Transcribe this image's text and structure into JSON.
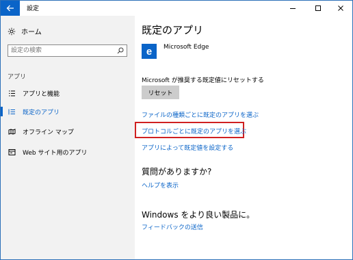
{
  "titlebar": {
    "title": "設定"
  },
  "sidebar": {
    "home_label": "ホーム",
    "search_placeholder": "設定の検索",
    "section_label": "アプリ",
    "items": [
      {
        "label": "アプリと機能",
        "icon": "list-icon",
        "active": false
      },
      {
        "label": "既定のアプリ",
        "icon": "default-apps-icon",
        "active": true
      },
      {
        "label": "オフライン マップ",
        "icon": "map-icon",
        "active": false
      },
      {
        "label": "Web サイト用のアプリ",
        "icon": "web-apps-icon",
        "active": false
      }
    ]
  },
  "main": {
    "title": "既定のアプリ",
    "browser": {
      "name": "Microsoft Edge",
      "icon_letter": "e"
    },
    "reset_description": "Microsoft が推奨する既定値にリセットする",
    "reset_button": "リセット",
    "links": [
      "ファイルの種類ごとに既定のアプリを選ぶ",
      "プロトコルごとに既定のアプリを選ぶ",
      "アプリによって既定値を設定する"
    ],
    "help": {
      "heading": "質問がありますか?",
      "link": "ヘルプを表示"
    },
    "feedback": {
      "heading": "Windows をより良い製品に。",
      "link": "フィードバックの送信"
    }
  },
  "colors": {
    "accent": "#0a64c8",
    "highlight": "#d02020",
    "sidebar_bg": "#f2f2f2"
  }
}
